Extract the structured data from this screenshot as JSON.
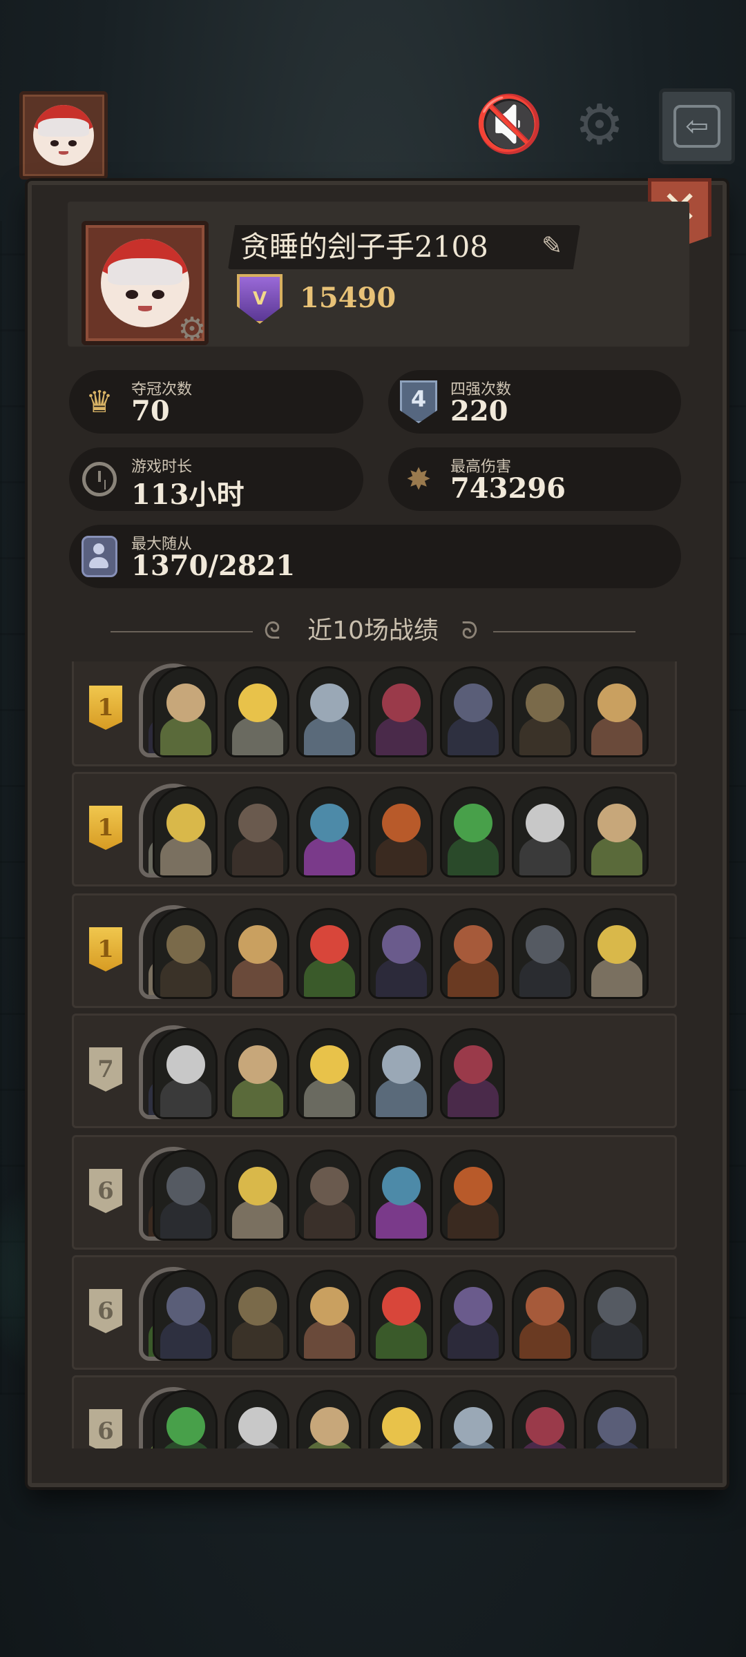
{
  "player": {
    "name": "贪睡的刽子手2108",
    "rank_score": "15490",
    "rank_badge_symbol": "V"
  },
  "stats": {
    "champion_label": "夺冠次数",
    "champion_value": "70",
    "top4_label": "四强次数",
    "top4_value": "220",
    "top4_symbol": "4",
    "playtime_label": "游戏时长",
    "playtime_value": "113小时",
    "max_damage_label": "最高伤害",
    "max_damage_value": "743296",
    "max_followers_label": "最大随从",
    "max_followers_value": "1370/2821"
  },
  "section_title": "近10场战绩",
  "icons": {
    "mute": "🔇",
    "gear": "⚙",
    "exit": "⇦",
    "close": "✕",
    "edit": "✎",
    "crown": "♛",
    "damage": "✸",
    "swirl_left": "ᘓ",
    "swirl_right": "ᘐ"
  },
  "colors": {
    "panel": "#2a2623",
    "gold_place": "#f0c74e",
    "plain_place": "#b8ad94",
    "close_button": "#a94d39",
    "score": "#e8c277"
  },
  "matches": [
    {
      "place": "1",
      "tier": "gold",
      "units": 7
    },
    {
      "place": "1",
      "tier": "gold",
      "units": 7
    },
    {
      "place": "1",
      "tier": "gold",
      "units": 7
    },
    {
      "place": "7",
      "tier": "plain",
      "units": 5
    },
    {
      "place": "6",
      "tier": "plain",
      "units": 5
    },
    {
      "place": "6",
      "tier": "plain",
      "units": 7
    },
    {
      "place": "6",
      "tier": "plain",
      "units": 7
    }
  ]
}
